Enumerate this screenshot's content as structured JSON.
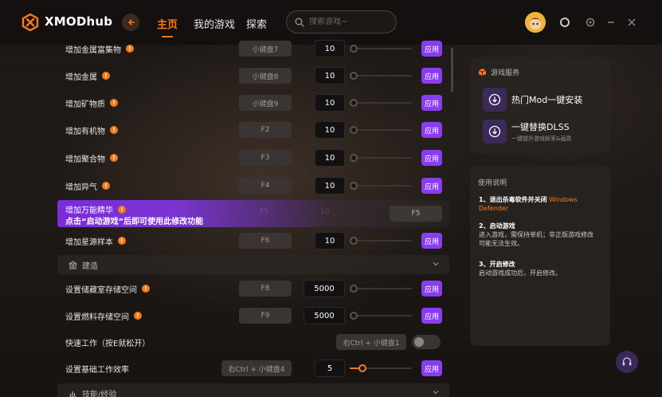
{
  "app": {
    "brand": "XMODhub"
  },
  "nav": {
    "home": "主页",
    "my_games": "我的游戏",
    "explore": "探索"
  },
  "search": {
    "placeholder": "搜索游戏~"
  },
  "colors": {
    "accent": "#ff7a1a",
    "apply": "#8a3cf0"
  },
  "rows": [
    {
      "label": "增加金属富集物",
      "key": "小键盘7",
      "value": "10",
      "apply": "应用"
    },
    {
      "label": "增加金属",
      "key": "小键盘8",
      "value": "10",
      "apply": "应用"
    },
    {
      "label": "增加矿物质",
      "key": "小键盘9",
      "value": "10",
      "apply": "应用"
    },
    {
      "label": "增加有机物",
      "key": "F2",
      "value": "10",
      "apply": "应用"
    },
    {
      "label": "增加聚合物",
      "key": "F3",
      "value": "10",
      "apply": "应用"
    },
    {
      "label": "增加异气",
      "key": "F4",
      "value": "10",
      "apply": "应用"
    }
  ],
  "highlight": {
    "label": "增加万能精华",
    "warning": "点击“启动游戏”后即可使用此修改功能",
    "key": "F5",
    "ghost_key": "F5",
    "ghost_value": "10"
  },
  "row_stellar": {
    "label": "增加星源样本",
    "key": "F6",
    "value": "10",
    "apply": "应用"
  },
  "section_build": {
    "title": "建造"
  },
  "build_rows": [
    {
      "label": "设置储藏室存储空间",
      "key": "F8",
      "value": "5000",
      "apply": "应用"
    },
    {
      "label": "设置燃料存储空间",
      "key": "F9",
      "value": "5000",
      "apply": "应用"
    }
  ],
  "fast_work": {
    "label": "快速工作（按E就松开）",
    "key": "右Ctrl + 小键盘1"
  },
  "work_eff": {
    "label": "设置基础工作效率",
    "key": "右Ctrl + 小键盘4",
    "value": "5",
    "apply": "应用",
    "level": 0.2
  },
  "section_skill": {
    "title": "技能/经验"
  },
  "services": {
    "title": "游戏服务",
    "items": [
      {
        "title": "热门Mod一键安装"
      },
      {
        "title": "一键替换DLSS",
        "sub": "一键提升游戏帧率&画质"
      }
    ]
  },
  "usage": {
    "title": "使用说明",
    "step1_title": "1、退出杀毒软件并关闭",
    "step1_hl": "Windows Defender",
    "step2_title": "2、启动游戏",
    "step2_body": "进入游戏，需保持单机；非正版游戏修改可能无法生效。",
    "step3_title": "3、开启修改",
    "step3_body": "启动游戏成功后，开启修改。"
  }
}
